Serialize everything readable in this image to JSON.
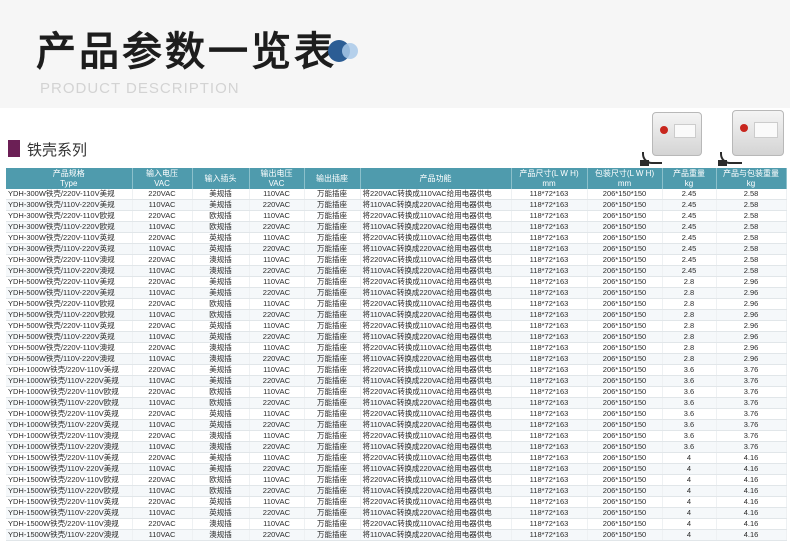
{
  "header": {
    "title": "产品参数一览表",
    "subtitle": "PRODUCT  DESCRIPTION"
  },
  "section": {
    "label": "铁壳系列"
  },
  "colors": {
    "table_header_bg": "#4f9bad",
    "section_mark": "#6b1f55",
    "accent_dark": "#2c5d94",
    "accent_light": "#a9c9e9"
  },
  "table": {
    "headers": [
      [
        "产品规格",
        "Type"
      ],
      [
        "输入电压",
        "VAC"
      ],
      [
        "输入插头",
        ""
      ],
      [
        "输出电压",
        "VAC"
      ],
      [
        "输出插座",
        ""
      ],
      [
        "产品功能",
        ""
      ],
      [
        "产品尺寸(L W H)",
        "mm"
      ],
      [
        "包装尺寸(L W H)",
        "mm"
      ],
      [
        "产品重量",
        "kg"
      ],
      [
        "产品与包装重量",
        "kg"
      ]
    ],
    "rows": [
      [
        "YDH-300W铁壳/220V-110V美规",
        "220VAC",
        "美规插",
        "110VAC",
        "万能插座",
        "将220VAC转换成110VAC给用电器供电",
        "118*72*163",
        "206*150*150",
        "2.45",
        "2.58"
      ],
      [
        "YDH-300W铁壳/110V-220V美规",
        "110VAC",
        "美规插",
        "220VAC",
        "万能插座",
        "将110VAC转换成220VAC给用电器供电",
        "118*72*163",
        "206*150*150",
        "2.45",
        "2.58"
      ],
      [
        "YDH-300W铁壳/220V-110V欧规",
        "220VAC",
        "欧规插",
        "110VAC",
        "万能插座",
        "将220VAC转换成110VAC给用电器供电",
        "118*72*163",
        "206*150*150",
        "2.45",
        "2.58"
      ],
      [
        "YDH-300W铁壳/110V-220V欧规",
        "110VAC",
        "欧规插",
        "220VAC",
        "万能插座",
        "将110VAC转换成220VAC给用电器供电",
        "118*72*163",
        "206*150*150",
        "2.45",
        "2.58"
      ],
      [
        "YDH-300W铁壳/220V-110V英规",
        "220VAC",
        "英规插",
        "110VAC",
        "万能插座",
        "将220VAC转换成110VAC给用电器供电",
        "118*72*163",
        "206*150*150",
        "2.45",
        "2.58"
      ],
      [
        "YDH-300W铁壳/110V-220V英规",
        "110VAC",
        "英规插",
        "220VAC",
        "万能插座",
        "将110VAC转换成220VAC给用电器供电",
        "118*72*163",
        "206*150*150",
        "2.45",
        "2.58"
      ],
      [
        "YDH-300W铁壳/220V-110V澳规",
        "220VAC",
        "澳规插",
        "110VAC",
        "万能插座",
        "将220VAC转换成110VAC给用电器供电",
        "118*72*163",
        "206*150*150",
        "2.45",
        "2.58"
      ],
      [
        "YDH-300W铁壳/110V-220V澳规",
        "110VAC",
        "澳规插",
        "220VAC",
        "万能插座",
        "将110VAC转换成220VAC给用电器供电",
        "118*72*163",
        "206*150*150",
        "2.45",
        "2.58"
      ],
      [
        "YDH-500W铁壳/220V-110V美规",
        "220VAC",
        "美规插",
        "110VAC",
        "万能插座",
        "将220VAC转换成110VAC给用电器供电",
        "118*72*163",
        "206*150*150",
        "2.8",
        "2.96"
      ],
      [
        "YDH-500W铁壳/110V-220V美规",
        "110VAC",
        "美规插",
        "220VAC",
        "万能插座",
        "将110VAC转换成220VAC给用电器供电",
        "118*72*163",
        "206*150*150",
        "2.8",
        "2.96"
      ],
      [
        "YDH-500W铁壳/220V-110V欧规",
        "220VAC",
        "欧规插",
        "110VAC",
        "万能插座",
        "将220VAC转换成110VAC给用电器供电",
        "118*72*163",
        "206*150*150",
        "2.8",
        "2.96"
      ],
      [
        "YDH-500W铁壳/110V-220V欧规",
        "110VAC",
        "欧规插",
        "220VAC",
        "万能插座",
        "将110VAC转换成220VAC给用电器供电",
        "118*72*163",
        "206*150*150",
        "2.8",
        "2.96"
      ],
      [
        "YDH-500W铁壳/220V-110V英规",
        "220VAC",
        "英规插",
        "110VAC",
        "万能插座",
        "将220VAC转换成110VAC给用电器供电",
        "118*72*163",
        "206*150*150",
        "2.8",
        "2.96"
      ],
      [
        "YDH-500W铁壳/110V-220V英规",
        "110VAC",
        "英规插",
        "220VAC",
        "万能插座",
        "将110VAC转换成220VAC给用电器供电",
        "118*72*163",
        "206*150*150",
        "2.8",
        "2.96"
      ],
      [
        "YDH-500W铁壳/220V-110V澳规",
        "220VAC",
        "澳规插",
        "110VAC",
        "万能插座",
        "将220VAC转换成110VAC给用电器供电",
        "118*72*163",
        "206*150*150",
        "2.8",
        "2.96"
      ],
      [
        "YDH-500W铁壳/110V-220V澳规",
        "110VAC",
        "澳规插",
        "220VAC",
        "万能插座",
        "将110VAC转换成220VAC给用电器供电",
        "118*72*163",
        "206*150*150",
        "2.8",
        "2.96"
      ],
      [
        "YDH-1000W铁壳/220V-110V美规",
        "220VAC",
        "美规插",
        "110VAC",
        "万能插座",
        "将220VAC转换成110VAC给用电器供电",
        "118*72*163",
        "206*150*150",
        "3.6",
        "3.76"
      ],
      [
        "YDH-1000W铁壳/110V-220V美规",
        "110VAC",
        "美规插",
        "220VAC",
        "万能插座",
        "将110VAC转换成220VAC给用电器供电",
        "118*72*163",
        "206*150*150",
        "3.6",
        "3.76"
      ],
      [
        "YDH-1000W铁壳/220V-110V欧规",
        "220VAC",
        "欧规插",
        "110VAC",
        "万能插座",
        "将220VAC转换成110VAC给用电器供电",
        "118*72*163",
        "206*150*150",
        "3.6",
        "3.76"
      ],
      [
        "YDH-1000W铁壳/110V-220V欧规",
        "110VAC",
        "欧规插",
        "220VAC",
        "万能插座",
        "将110VAC转换成220VAC给用电器供电",
        "118*72*163",
        "206*150*150",
        "3.6",
        "3.76"
      ],
      [
        "YDH-1000W铁壳/220V-110V英规",
        "220VAC",
        "英规插",
        "110VAC",
        "万能插座",
        "将220VAC转换成110VAC给用电器供电",
        "118*72*163",
        "206*150*150",
        "3.6",
        "3.76"
      ],
      [
        "YDH-1000W铁壳/110V-220V英规",
        "110VAC",
        "英规插",
        "220VAC",
        "万能插座",
        "将110VAC转换成220VAC给用电器供电",
        "118*72*163",
        "206*150*150",
        "3.6",
        "3.76"
      ],
      [
        "YDH-1000W铁壳/220V-110V澳规",
        "220VAC",
        "澳规插",
        "110VAC",
        "万能插座",
        "将220VAC转换成110VAC给用电器供电",
        "118*72*163",
        "206*150*150",
        "3.6",
        "3.76"
      ],
      [
        "YDH-1000W铁壳/110V-220V澳规",
        "110VAC",
        "澳规插",
        "220VAC",
        "万能插座",
        "将110VAC转换成220VAC给用电器供电",
        "118*72*163",
        "206*150*150",
        "3.6",
        "3.76"
      ],
      [
        "YDH-1500W铁壳/220V-110V美规",
        "220VAC",
        "美规插",
        "110VAC",
        "万能插座",
        "将220VAC转换成110VAC给用电器供电",
        "118*72*163",
        "206*150*150",
        "4",
        "4.16"
      ],
      [
        "YDH-1500W铁壳/110V-220V美规",
        "110VAC",
        "美规插",
        "220VAC",
        "万能插座",
        "将110VAC转换成220VAC给用电器供电",
        "118*72*163",
        "206*150*150",
        "4",
        "4.16"
      ],
      [
        "YDH-1500W铁壳/220V-110V欧规",
        "220VAC",
        "欧规插",
        "110VAC",
        "万能插座",
        "将220VAC转换成110VAC给用电器供电",
        "118*72*163",
        "206*150*150",
        "4",
        "4.16"
      ],
      [
        "YDH-1500W铁壳/110V-220V欧规",
        "110VAC",
        "欧规插",
        "220VAC",
        "万能插座",
        "将110VAC转换成220VAC给用电器供电",
        "118*72*163",
        "206*150*150",
        "4",
        "4.16"
      ],
      [
        "YDH-1500W铁壳/220V-110V英规",
        "220VAC",
        "英规插",
        "110VAC",
        "万能插座",
        "将220VAC转换成110VAC给用电器供电",
        "118*72*163",
        "206*150*150",
        "4",
        "4.16"
      ],
      [
        "YDH-1500W铁壳/110V-220V英规",
        "110VAC",
        "英规插",
        "220VAC",
        "万能插座",
        "将110VAC转换成220VAC给用电器供电",
        "118*72*163",
        "206*150*150",
        "4",
        "4.16"
      ],
      [
        "YDH-1500W铁壳/220V-110V澳规",
        "220VAC",
        "澳规插",
        "110VAC",
        "万能插座",
        "将220VAC转换成110VAC给用电器供电",
        "118*72*163",
        "206*150*150",
        "4",
        "4.16"
      ],
      [
        "YDH-1500W铁壳/110V-220V澳规",
        "110VAC",
        "澳规插",
        "220VAC",
        "万能插座",
        "将110VAC转换成220VAC给用电器供电",
        "118*72*163",
        "206*150*150",
        "4",
        "4.16"
      ]
    ]
  }
}
